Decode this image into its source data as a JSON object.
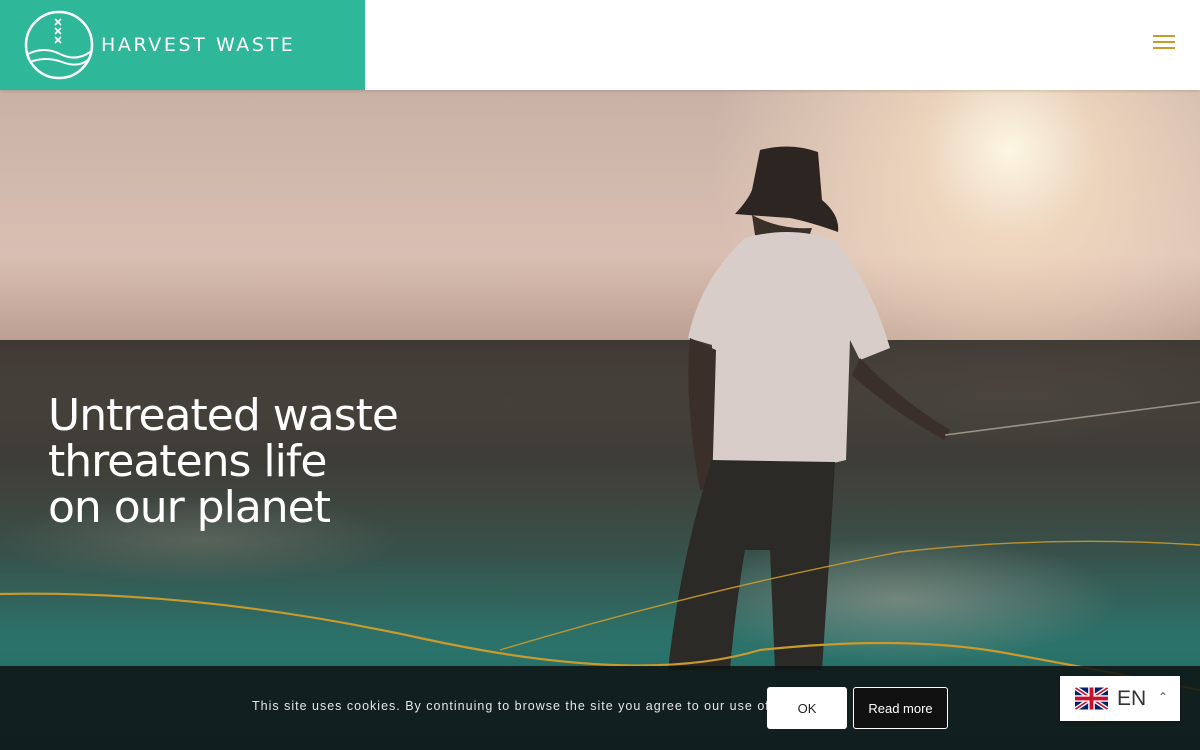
{
  "header": {
    "brand_name": "HARVEST WASTE",
    "logo_icon": "harvest-waste-logo-icon",
    "menu_icon": "hamburger-menu-icon"
  },
  "hero": {
    "title_lines": [
      "Untreated waste",
      "threatens life",
      "on our planet"
    ]
  },
  "cookie_bar": {
    "message": "This site uses cookies. By continuing to browse the site you agree to our use of cookies.",
    "ok_label": "OK",
    "read_more_label": "Read more"
  },
  "language": {
    "code": "EN",
    "flag_icon": "uk-flag-icon",
    "caret_icon": "chevron-up-icon"
  },
  "colors": {
    "brand": "#2fb79a",
    "accent": "#c99a2e"
  }
}
